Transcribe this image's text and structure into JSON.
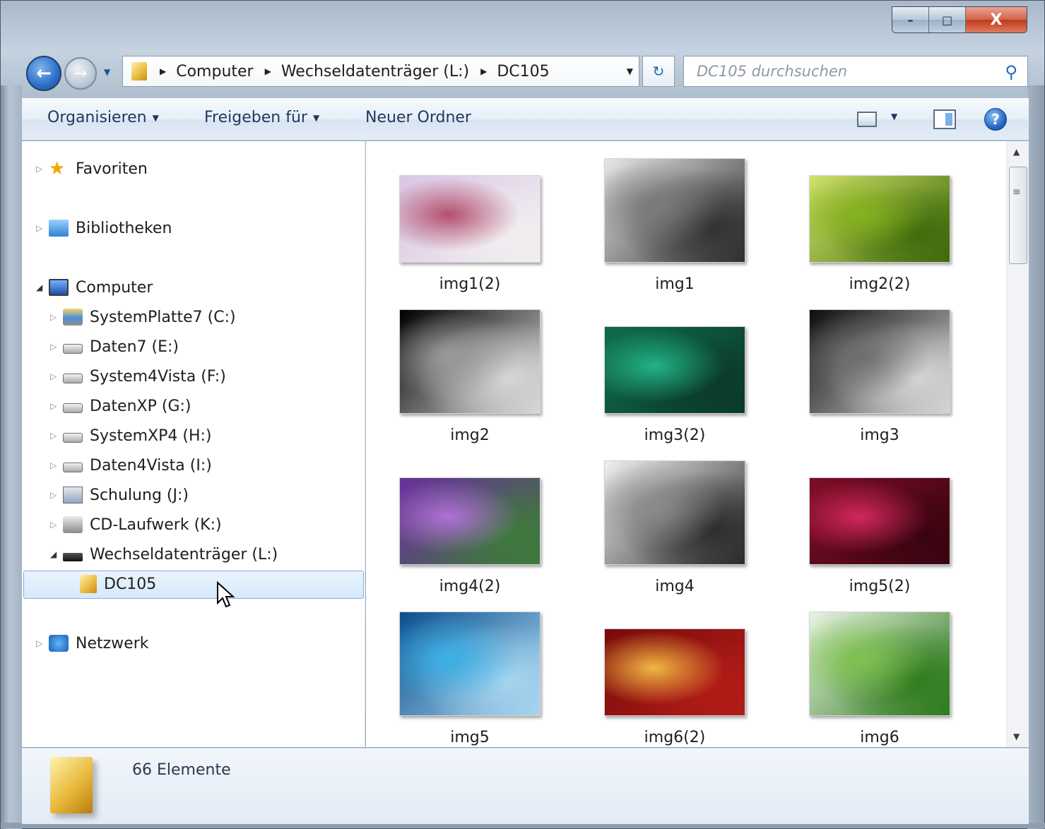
{
  "window": {
    "caption_buttons": {
      "minimize": "–",
      "maximize": "□",
      "close": "X"
    }
  },
  "nav": {
    "back_glyph": "←",
    "forward_glyph": "→",
    "dropdown_glyph": "▼",
    "breadcrumb": [
      "Computer",
      "Wechseldatenträger (L:)",
      "DC105"
    ],
    "breadcrumb_sep": "▶",
    "address_dropdown": "▼",
    "refresh_glyph": "↻",
    "search_placeholder": "DC105 durchsuchen",
    "search_value": "",
    "search_icon": "⚲"
  },
  "toolbar": {
    "organize": "Organisieren",
    "share": "Freigeben für",
    "new_folder": "Neuer Ordner",
    "dropdown_glyph": "▼",
    "help_glyph": "?"
  },
  "tree": {
    "favorites": "Favoriten",
    "libraries": "Bibliotheken",
    "computer": "Computer",
    "drives": [
      {
        "label": "SystemPlatte7 (C:)",
        "icon": "system-drive-icon"
      },
      {
        "label": "Daten7 (E:)",
        "icon": "hard-drive-icon"
      },
      {
        "label": "System4Vista (F:)",
        "icon": "hard-drive-icon"
      },
      {
        "label": "DatenXP (G:)",
        "icon": "hard-drive-icon"
      },
      {
        "label": "SystemXP4 (H:)",
        "icon": "hard-drive-icon"
      },
      {
        "label": "Daten4Vista (I:)",
        "icon": "hard-drive-icon"
      },
      {
        "label": "Schulung (J:)",
        "icon": "network-drive-icon"
      },
      {
        "label": "CD-Laufwerk (K:)",
        "icon": "cd-drive-icon"
      },
      {
        "label": "Wechseldatenträger (L:)",
        "icon": "usb-drive-icon"
      }
    ],
    "current_folder": "DC105",
    "network": "Netzwerk",
    "collapsed_glyph": "▷",
    "expanded_glyph": "◢"
  },
  "files": [
    {
      "name": "img1(2)",
      "colors": [
        "#d9c7e4",
        "#b34f6f",
        "#f1eef0"
      ]
    },
    {
      "name": "img1",
      "colors": [
        "#e7e7e7",
        "#7a7a7a",
        "#2f2f2f"
      ]
    },
    {
      "name": "img2(2)",
      "colors": [
        "#cfe26a",
        "#86b21d",
        "#3f6a0b"
      ]
    },
    {
      "name": "img2",
      "colors": [
        "#000000",
        "#9a9a9a",
        "#d9d9d9"
      ]
    },
    {
      "name": "img3(2)",
      "colors": [
        "#0f6b4a",
        "#22b386",
        "#0b3a2a"
      ]
    },
    {
      "name": "img3",
      "colors": [
        "#0c0c0c",
        "#6e6e6e",
        "#d6d6d6"
      ]
    },
    {
      "name": "img4(2)",
      "colors": [
        "#6a2f9c",
        "#b06fd8",
        "#3d7a3a"
      ]
    },
    {
      "name": "img4",
      "colors": [
        "#f0f0f0",
        "#8a8a8a",
        "#2b2b2b"
      ]
    },
    {
      "name": "img5(2)",
      "colors": [
        "#7c0d25",
        "#d2285c",
        "#3a0410"
      ]
    },
    {
      "name": "img5",
      "colors": [
        "#0b4f8e",
        "#3ab0e6",
        "#a7d6f0"
      ]
    },
    {
      "name": "img6(2)",
      "colors": [
        "#7a0b0b",
        "#f0b742",
        "#b11c17"
      ]
    },
    {
      "name": "img6",
      "colors": [
        "#e9f3e2",
        "#7ec24e",
        "#2e7a1d"
      ]
    }
  ],
  "details": {
    "count_text": "66 Elemente"
  },
  "colors": {
    "accent": "#1e395b",
    "selection": "#d5e9fb"
  }
}
